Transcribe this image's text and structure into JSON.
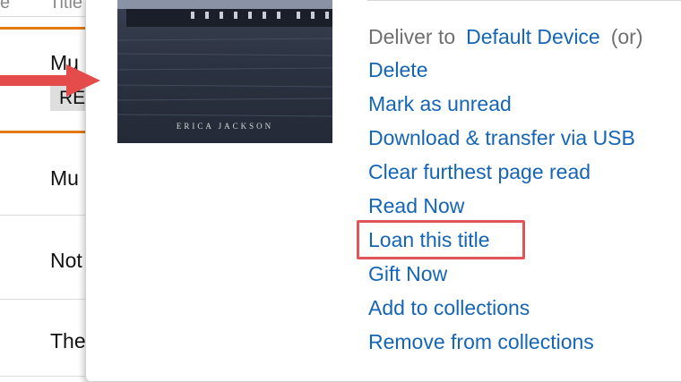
{
  "background_list": {
    "header_left": "e",
    "header_title": "Title",
    "rows": [
      {
        "title_fragment": "Mu",
        "badge": "RE"
      },
      {
        "title_fragment": "Mu"
      },
      {
        "title_fragment": "Not"
      },
      {
        "title_fragment": "The"
      }
    ]
  },
  "book": {
    "author": "ERICA JACKSON"
  },
  "deliver": {
    "label": "Deliver to",
    "device_link": "Default Device",
    "suffix": "(or)"
  },
  "actions": [
    "Delete",
    "Mark as unread",
    "Download & transfer via USB",
    "Clear furthest page read",
    "Read Now",
    "Loan this title",
    "Gift Now",
    "Add to collections",
    "Remove from collections"
  ],
  "highlighted_action": "Loan this title",
  "colors": {
    "link": "#1565b6",
    "highlight": "#e0555a",
    "arrow": "#e44b4b",
    "selection_line": "#e47911"
  }
}
